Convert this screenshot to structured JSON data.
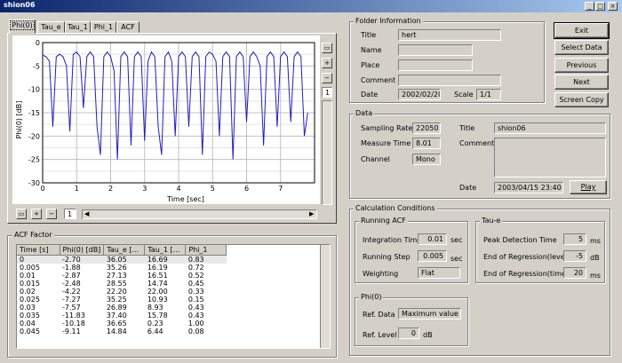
{
  "window": {
    "title": "shion06"
  },
  "tabs": [
    "Phi(0)",
    "Tau_e",
    "Tau_1",
    "Phi_1",
    "ACF"
  ],
  "chart_data": {
    "type": "line",
    "xlabel": "Time [sec]",
    "ylabel": "Phi(0) [dB]",
    "xlim": [
      0,
      8
    ],
    "ylim": [
      -30,
      0
    ],
    "xticks": [
      0,
      1,
      2,
      3,
      4,
      5,
      6,
      7
    ],
    "yticks": [
      0,
      -5,
      -10,
      -15,
      -20,
      -25,
      -30
    ],
    "grid": true,
    "series": [
      {
        "color": "#1f1fbf",
        "x": [
          0,
          0.1,
          0.2,
          0.3,
          0.4,
          0.5,
          0.6,
          0.7,
          0.8,
          0.9,
          1.0,
          1.1,
          1.2,
          1.3,
          1.4,
          1.5,
          1.6,
          1.7,
          1.8,
          1.9,
          2.0,
          2.1,
          2.2,
          2.3,
          2.4,
          2.5,
          2.6,
          2.7,
          2.8,
          2.9,
          3.0,
          3.1,
          3.2,
          3.3,
          3.4,
          3.5,
          3.6,
          3.7,
          3.8,
          3.9,
          4.0,
          4.1,
          4.2,
          4.3,
          4.4,
          4.5,
          4.6,
          4.7,
          4.8,
          4.9,
          5.0,
          5.1,
          5.2,
          5.3,
          5.4,
          5.5,
          5.6,
          5.7,
          5.8,
          5.9,
          6.0,
          6.1,
          6.2,
          6.3,
          6.4,
          6.5,
          6.6,
          6.7,
          6.8,
          6.9,
          7.0,
          7.1,
          7.2,
          7.3,
          7.4,
          7.5,
          7.6,
          7.7,
          7.8
        ],
        "y": [
          -2.7,
          -3,
          -4,
          -18,
          -3,
          -2.5,
          -3,
          -5,
          -19,
          -2.5,
          -2,
          -3,
          -14,
          -3,
          -2,
          -3,
          -18,
          -24,
          -3,
          -2,
          -3,
          -6,
          -25,
          -3,
          -2,
          -3,
          -22,
          -3,
          -2,
          -3,
          -21,
          -4,
          -2,
          -3,
          -18,
          -24,
          -3,
          -2,
          -4,
          -20,
          -3,
          -2,
          -3,
          -18,
          -3,
          -2,
          -3,
          -24,
          -3,
          -2,
          -2.5,
          -4,
          -20,
          -3,
          -2,
          -3,
          -25,
          -3,
          -2,
          -3,
          -17,
          -3,
          -2,
          -3,
          -5,
          -22,
          -3,
          -2,
          -3,
          -18,
          -3,
          -2,
          -3,
          -17,
          -3,
          -2,
          -3,
          -20,
          -15
        ]
      }
    ]
  },
  "folder": {
    "group": "Folder Information",
    "title_label": "Title",
    "title": "hert",
    "name_label": "Name",
    "name": "",
    "place_label": "Place",
    "place": "",
    "comment_label": "Comment",
    "comment": "",
    "date_label": "Date",
    "date": "2002/02/20",
    "scale_label": "Scale",
    "scale": "1/1"
  },
  "buttons": {
    "exit": "Exit",
    "select": "Select Data",
    "previous": "Previous",
    "next": "Next",
    "screen_copy": "Screen Copy",
    "play": "Play"
  },
  "data": {
    "group": "Data",
    "sr_label": "Sampling Rate",
    "sr": "22050",
    "mt_label": "Measure Time",
    "mt": "8.01",
    "ch_label": "Channel",
    "ch": "Mono",
    "title_label": "Title",
    "title": "shion06",
    "comment_label": "Comment",
    "date_label": "Date",
    "date": "2003/04/15 23:40:18"
  },
  "calc": {
    "group": "Calculation Conditions",
    "racf": "Running ACF",
    "it_label": "Integration Time",
    "it": "0.01",
    "it_unit": "sec",
    "rs_label": "Running Step",
    "rs": "0.005",
    "rs_unit": "sec",
    "w_label": "Weighting",
    "w": "Flat",
    "taue": "Tau-e",
    "pd_label": "Peak Detection Time",
    "pd": "5",
    "pd_unit": "ms",
    "el_label": "End of Regression(level)",
    "el": "-5",
    "el_unit": "dB",
    "et_label": "End of Regression(time)",
    "et": "20",
    "et_unit": "ms",
    "phi": "Phi(0)",
    "rd_label": "Ref. Data",
    "rd": "Maximum value",
    "rl_label": "Ref. Level",
    "rl": "0",
    "rl_unit": "dB"
  },
  "acf": {
    "group": "ACF Factor",
    "columns": [
      "Time [s]",
      "Phi(0) [dB]",
      "Tau_e [...",
      "Tau_1 [...",
      "Phi_1"
    ],
    "rows": [
      [
        "0",
        "-2.70",
        "36.05",
        "16.69",
        "0.83"
      ],
      [
        "0.005",
        "-1.88",
        "35.26",
        "16.19",
        "0.72"
      ],
      [
        "0.01",
        "-2.87",
        "27.13",
        "16.51",
        "0.52"
      ],
      [
        "0.015",
        "-2.48",
        "28.55",
        "14.74",
        "0.45"
      ],
      [
        "0.02",
        "-4.22",
        "22.20",
        "22.00",
        "0.33"
      ],
      [
        "0.025",
        "-7.27",
        "35.25",
        "10.93",
        "0.15"
      ],
      [
        "0.03",
        "-7.57",
        "26.89",
        "8.93",
        "0.43"
      ],
      [
        "0.035",
        "-11.83",
        "37.40",
        "15.78",
        "0.43"
      ],
      [
        "0.04",
        "-10.18",
        "36.65",
        "0.23",
        "1.00"
      ],
      [
        "0.045",
        "-9.11",
        "14.84",
        "6.44",
        "0.08"
      ]
    ]
  },
  "spin": {
    "value": "1"
  }
}
